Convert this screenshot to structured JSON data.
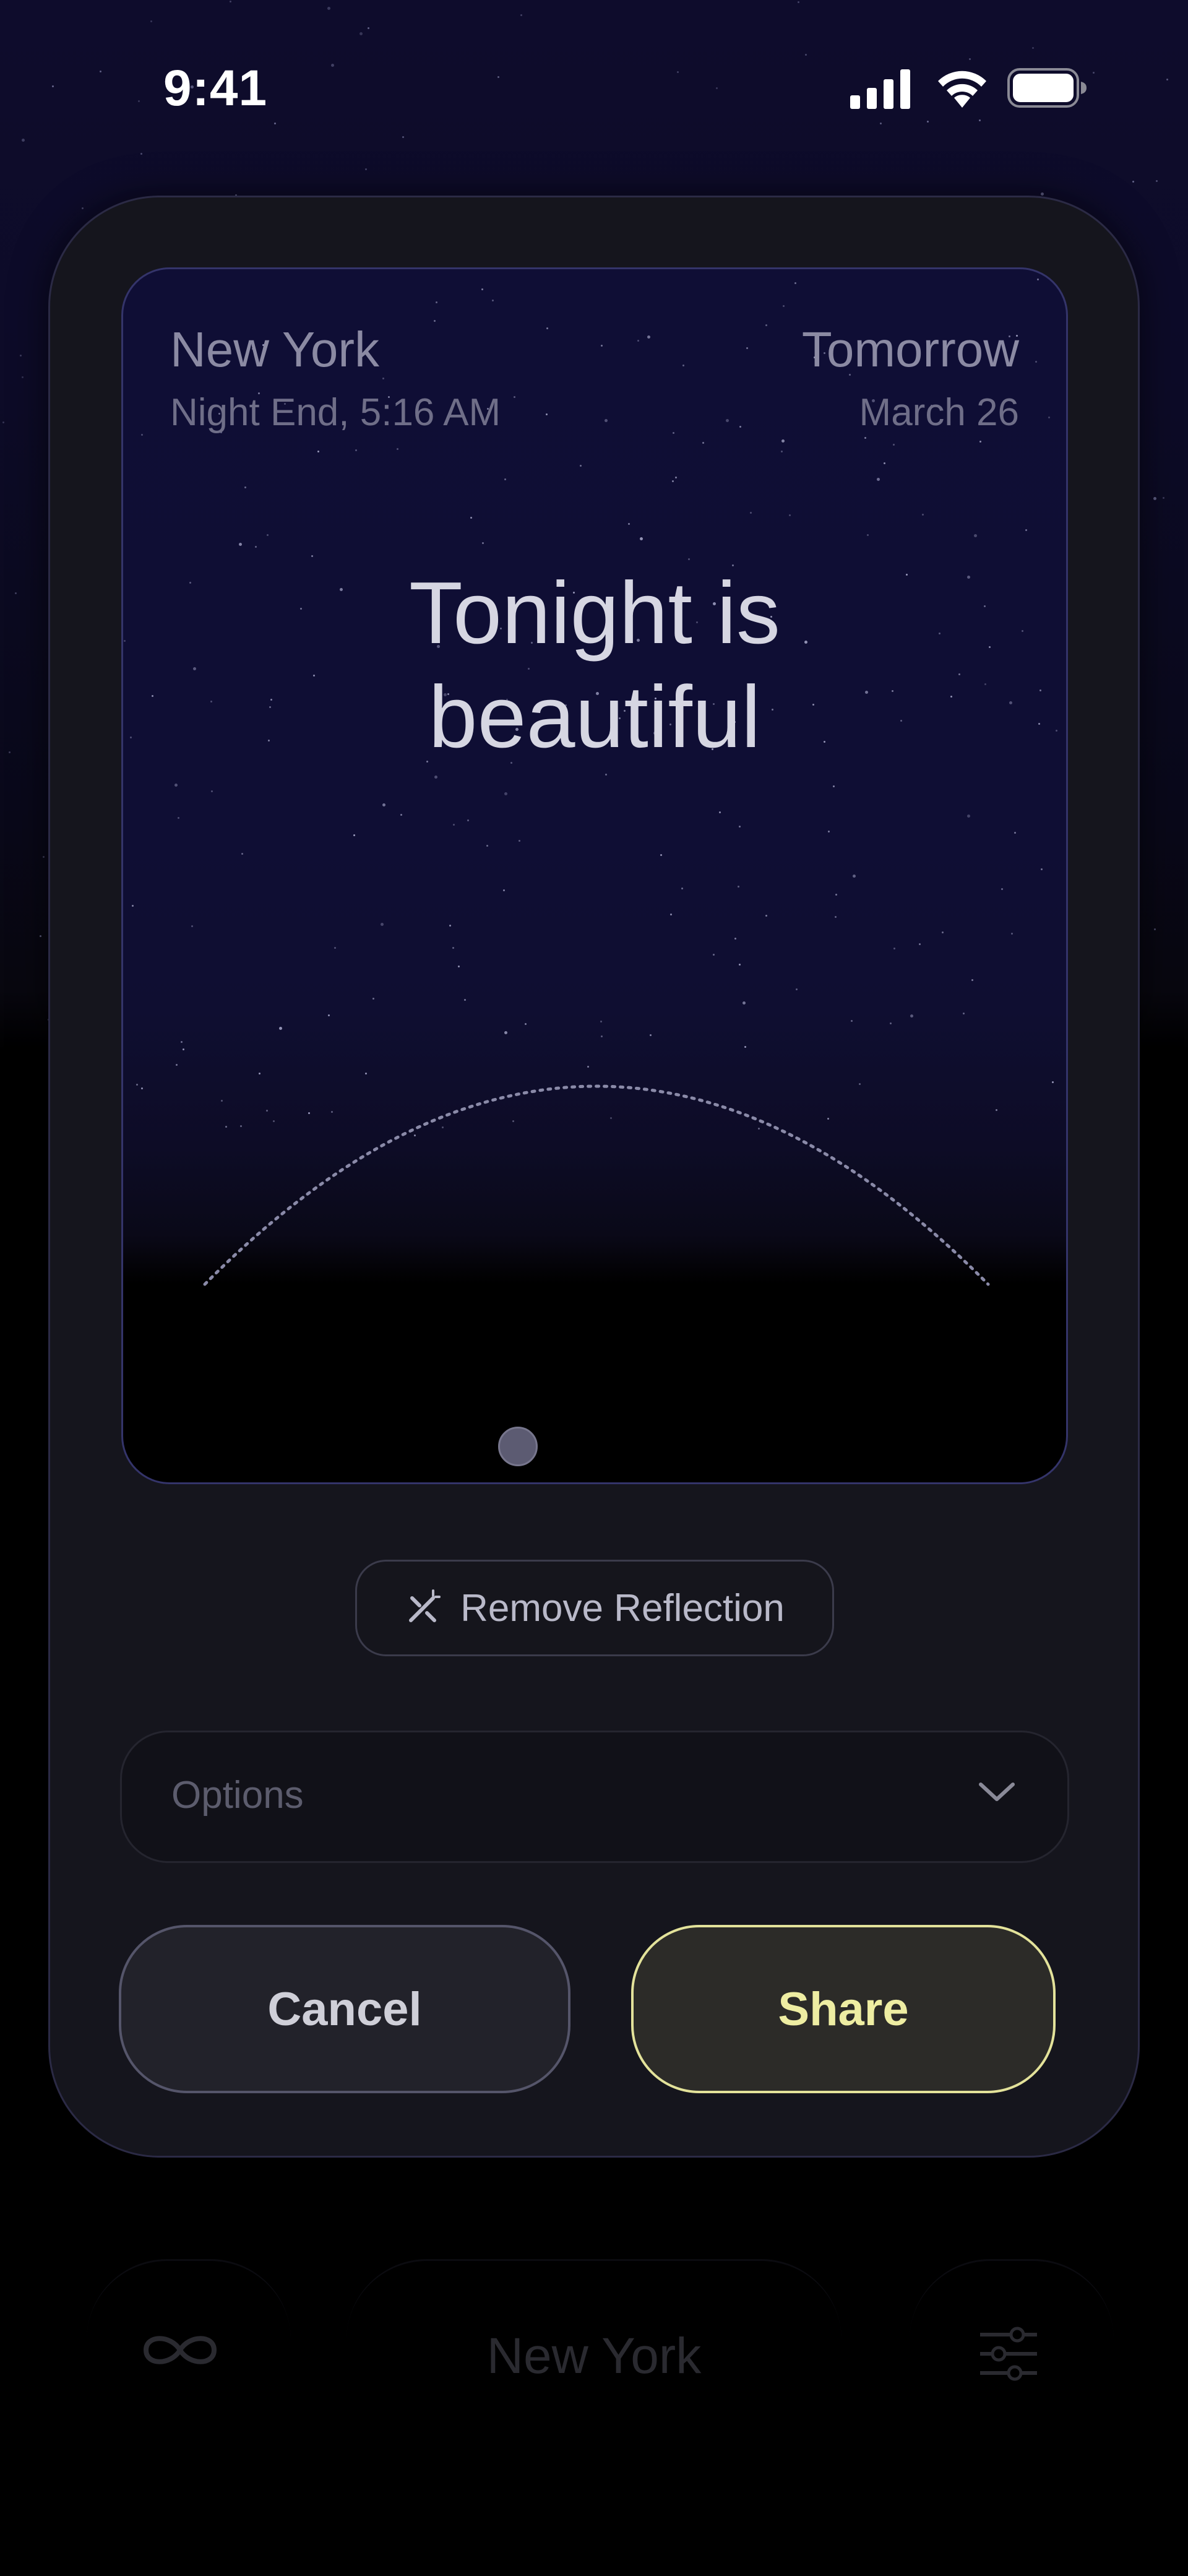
{
  "status_bar": {
    "time": "9:41",
    "icons": [
      "signal-icon",
      "wifi-icon",
      "battery-icon"
    ]
  },
  "card": {
    "location": "New York",
    "subtitle": "Night End, 5:16 AM",
    "day": "Tomorrow",
    "date": "March 26",
    "headline_line1": "Tonight is",
    "headline_line2": "beautiful"
  },
  "remove_reflection": {
    "label": "Remove Reflection",
    "icon": "sparkle-remove-icon"
  },
  "options": {
    "label": "Options",
    "icon": "chevron-down-icon"
  },
  "actions": {
    "cancel_label": "Cancel",
    "share_label": "Share"
  },
  "tab_bar": {
    "location": "New York",
    "left_icon": "infinity-icon",
    "right_icon": "sliders-icon"
  },
  "colors": {
    "accent": "#eeeda2",
    "sheet": "#15151d",
    "sky": "#0f0e35"
  }
}
